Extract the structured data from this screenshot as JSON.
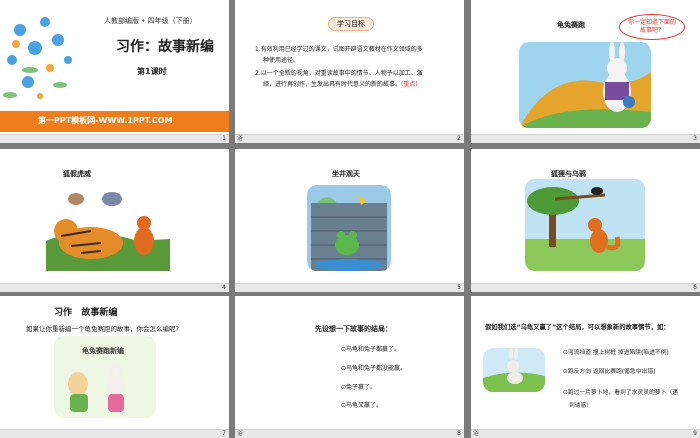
{
  "slides": [
    {
      "num": "1",
      "publisher": "人教部编版 • 四年级（下册）",
      "title": "习作：故事新编",
      "lesson": "第1课时",
      "banner": "第一PPT模板网-WWW.1PPT.COM"
    },
    {
      "num": "2",
      "note": "浴",
      "heading": "学习目标",
      "line1a": "1.有效利用已经学过的课文，试图开辟语文教材在作文领域的多",
      "line1b": "种使用途径。",
      "line2a": "2.以一个全新的视角，对重读故事中的情节、人物予以加工、演",
      "line2b": "绎，进行再创作，生发出具有时代意义的新的故事。",
      "key": "(重点)"
    },
    {
      "num": "3",
      "title": "龟兔赛跑",
      "bubble": "你一定知道下面的故事吧？"
    },
    {
      "num": "4",
      "title": "狐假虎威"
    },
    {
      "num": "5",
      "title": "坐井观天"
    },
    {
      "num": "6",
      "title": "狐狸与乌鸦"
    },
    {
      "num": "7",
      "title": "习作   故事新编",
      "question": "如果让你重新编一个龟兔赛跑的故事，你会怎么编呢?",
      "book": "龟兔赛跑新编"
    },
    {
      "num": "8",
      "note": "浴",
      "heading": "先设想一下故事的结局：",
      "o1": "⊙乌龟和兔子都赢了。",
      "o2": "⊙乌龟和兔子都没能赢。",
      "o3": "⊙兔子赢了。",
      "o4": "⊙乌龟又赢了。"
    },
    {
      "num": "9",
      "note": "浴",
      "heading": "假如我们选“乌龟又赢了”这个结局，可以想象新的故事情节，如：",
      "p1": "⊙河流挡道  撞上树桩  掉进陷阱(陷进不例)",
      "p2": "⊙跑反方向  返回比赛跑(循急中出错)",
      "p3a": "⊙跑过一片萝卜地，看到了水灵灵的萝卜（遇",
      "p3b": "到诱惑）"
    }
  ],
  "colors": {
    "orange": "#f07d1c",
    "red": "#e8302a",
    "green": "#6ab24e",
    "bg": "#7a7a7a"
  }
}
